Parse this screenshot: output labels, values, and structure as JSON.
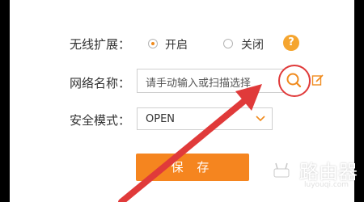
{
  "wireless_extension": {
    "label": "无线扩展：",
    "options": [
      {
        "label": "开启",
        "selected": true
      },
      {
        "label": "关闭",
        "selected": false
      }
    ],
    "help_icon": "question-icon"
  },
  "network_name": {
    "label": "网络名称：",
    "placeholder": "请手动输入或扫描选择",
    "search_icon": "search-icon",
    "edit_icon": "edit-icon"
  },
  "security_mode": {
    "label": "安全模式：",
    "value": "OPEN"
  },
  "save_label": "保 存",
  "watermark": {
    "text": "路由器",
    "sub": "luyouqi.com"
  },
  "colors": {
    "accent": "#f5851f",
    "annotation": "#e03a3a",
    "help": "#f5a52f"
  }
}
